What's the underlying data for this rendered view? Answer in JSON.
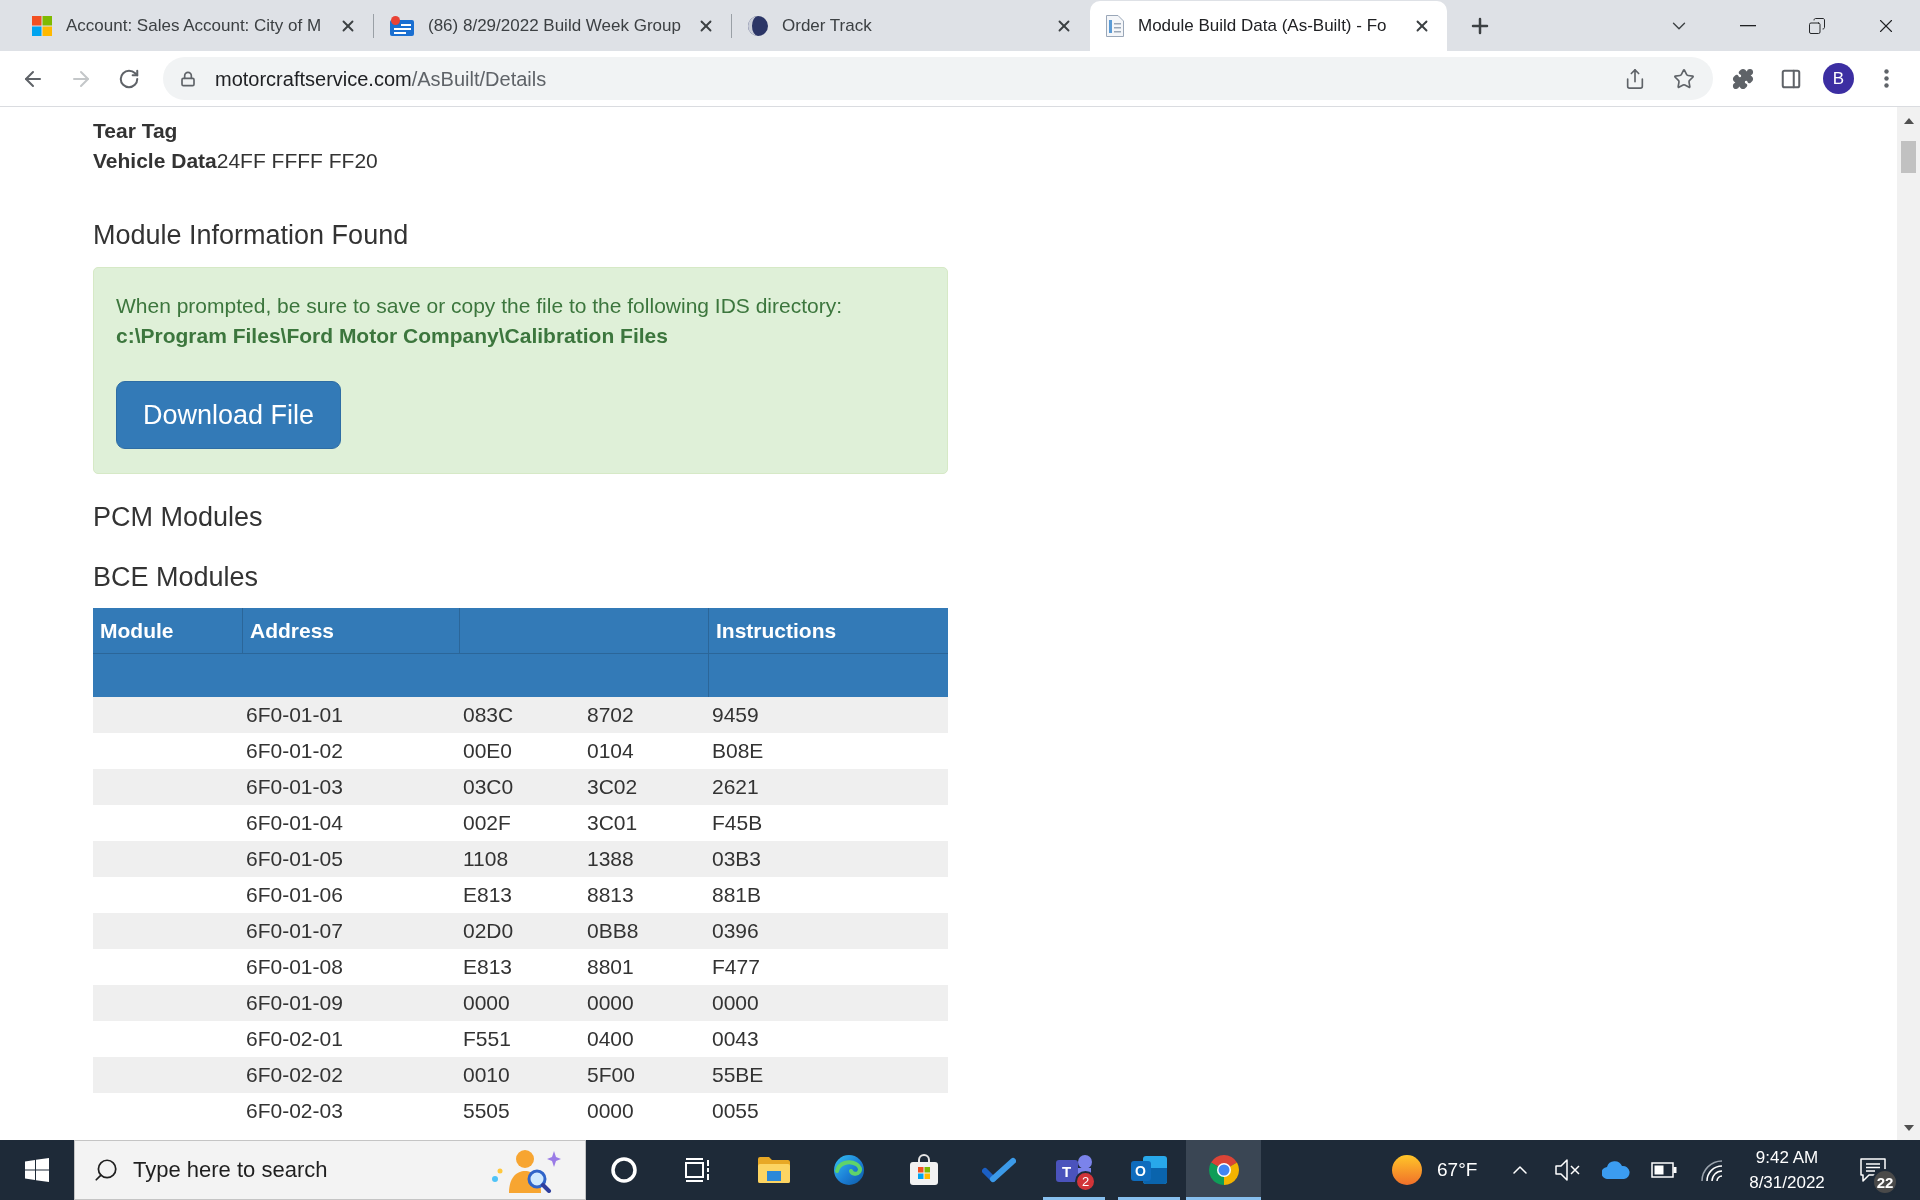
{
  "browser": {
    "tabs": [
      {
        "title": "Account: Sales Account: City of M",
        "selected": false
      },
      {
        "title": "(86) 8/29/2022 Build Week Group",
        "selected": false
      },
      {
        "title": "Order Track",
        "selected": false
      },
      {
        "title": "Module Build Data (As-Built) - Fo",
        "selected": true
      }
    ],
    "toolbar": {
      "back_disabled": false,
      "forward_disabled": true,
      "url_host": "motorcraftservice.com",
      "url_path": "/AsBuilt/Details",
      "bookmarked": false,
      "profile_initial": "B"
    }
  },
  "page": {
    "fields": [
      {
        "label": "Tear Tag"
      },
      {
        "label": "Vehicle Data",
        "value": "24FF FFFF FF20"
      }
    ],
    "section_title": "Module Information Found",
    "alert": {
      "message": "When prompted, be sure to save or copy the file to the following IDS directory:",
      "path": "c:\\Program Files\\Ford Motor Company\\Calibration Files",
      "button": "Download File"
    },
    "module_groups": [
      {
        "title": "PCM Modules"
      },
      {
        "title": "BCE Modules",
        "table": {
          "columns": [
            "Module",
            "Address",
            "",
            "",
            "Instructions"
          ],
          "rows": [
            {
              "cells": [
                "",
                "6F0-01-01",
                "083C",
                "8702",
                "9459"
              ]
            },
            {
              "cells": [
                "",
                "6F0-01-02",
                "00E0",
                "0104",
                "B08E"
              ]
            },
            {
              "cells": [
                "",
                "6F0-01-03",
                "03C0",
                "3C02",
                "2621"
              ]
            },
            {
              "cells": [
                "",
                "6F0-01-04",
                "002F",
                "3C01",
                "F45B"
              ]
            },
            {
              "cells": [
                "",
                "6F0-01-05",
                "1108",
                "1388",
                "03B3"
              ]
            },
            {
              "cells": [
                "",
                "6F0-01-06",
                "E813",
                "8813",
                "881B"
              ]
            },
            {
              "cells": [
                "",
                "6F0-01-07",
                "02D0",
                "0BB8",
                "0396"
              ]
            },
            {
              "cells": [
                "",
                "6F0-01-08",
                "E813",
                "8801",
                "F477"
              ]
            },
            {
              "cells": [
                "",
                "6F0-01-09",
                "0000",
                "0000",
                "0000"
              ]
            },
            {
              "cells": [
                "",
                "6F0-02-01",
                "F551",
                "0400",
                "0043"
              ]
            },
            {
              "cells": [
                "",
                "6F0-02-02",
                "0010",
                "5F00",
                "55BE"
              ]
            },
            {
              "cells": [
                "",
                "6F0-02-03",
                "5505",
                "0000",
                "0055"
              ]
            }
          ]
        }
      }
    ]
  },
  "taskbar": {
    "search": {
      "placeholder": "Type here to search"
    },
    "apps": [
      {
        "running": false,
        "selected": false
      },
      {
        "running": false,
        "selected": false
      },
      {
        "running": false,
        "selected": false
      },
      {
        "running": false,
        "selected": false
      },
      {
        "running": true,
        "selected": false,
        "letter": "T",
        "badge": "2"
      },
      {
        "running": true,
        "selected": false,
        "letter": "O"
      },
      {
        "running": true,
        "selected": true
      }
    ],
    "tray": {
      "weather": "67°F",
      "muted": true,
      "time": "9:42 AM",
      "date": "8/31/2022",
      "notifications": "22"
    }
  }
}
